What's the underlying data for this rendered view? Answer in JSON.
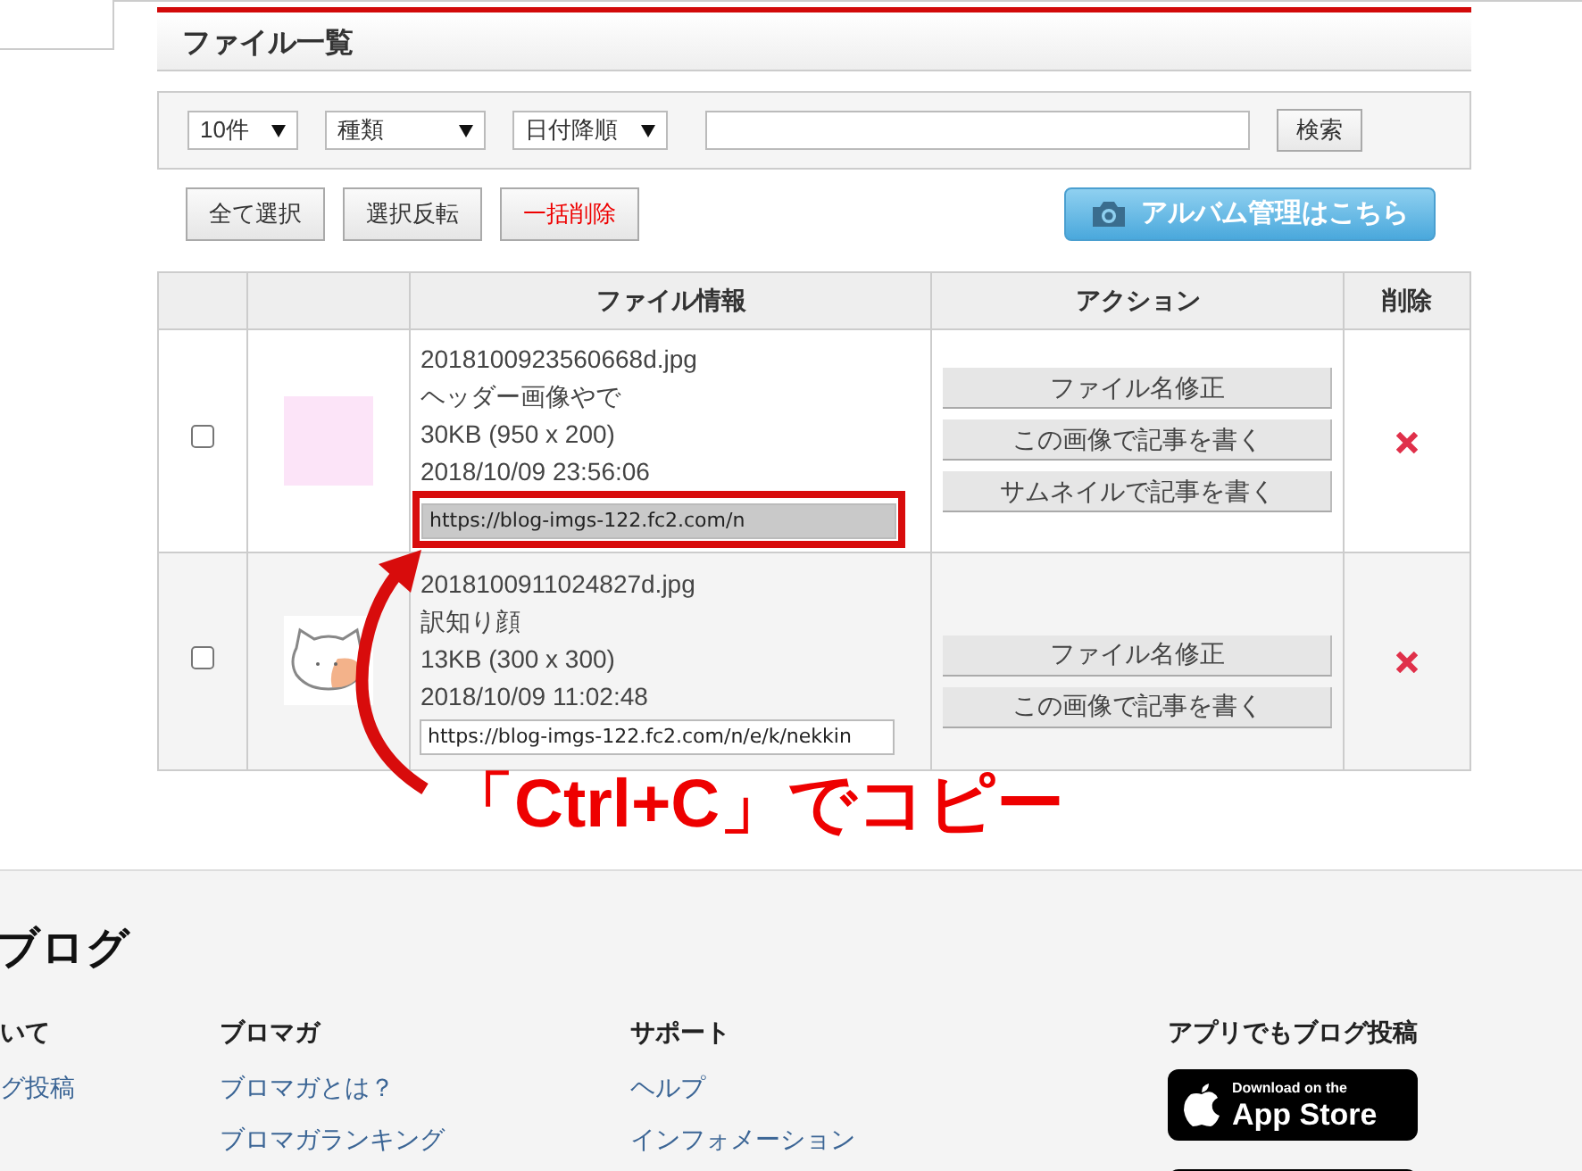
{
  "page_title": "ファイル一覧",
  "filters": {
    "count": "10件",
    "type": "種類",
    "sort": "日付降順",
    "search_button": "検索"
  },
  "actions": [
    {
      "label": "全て選択",
      "kind": "normal"
    },
    {
      "label": "選択反転",
      "kind": "normal"
    },
    {
      "label": "一括削除",
      "kind": "danger"
    }
  ],
  "album_button": "アルバム管理はこちら",
  "table": {
    "columns": [
      "ファイル情報",
      "アクション",
      "削除"
    ],
    "rows": [
      {
        "checked": false,
        "kind": "swatch",
        "filename": "2018100923560668d.jpg",
        "caption": "ヘッダー画像やで",
        "size": "30KB (950 x 200)",
        "date": "2018/10/09 23:56:06",
        "url": "https://blog-imgs-122.fc2.com/n",
        "highlighted": true,
        "buttons": [
          "ファイル名修正",
          "この画像で記事を書く",
          "サムネイルで記事を書く"
        ]
      },
      {
        "checked": false,
        "kind": "cat",
        "filename": "2018100911024827d.jpg",
        "caption": "訳知り顔",
        "size": "13KB (300 x 300)",
        "date": "2018/10/09 11:02:48",
        "url": "https://blog-imgs-122.fc2.com/n/e/k/nekkin",
        "highlighted": false,
        "buttons": [
          "ファイル名修正",
          "この画像で記事を書く"
        ]
      }
    ]
  },
  "annotation": {
    "text": "「Ctrl+C」でコピー"
  },
  "footer": {
    "heading": "ブログ",
    "columns": [
      {
        "title": "いて",
        "links": [
          "グ投稿"
        ]
      },
      {
        "title": "ブロマガ",
        "links": [
          "ブロマガとは？",
          "ブロマガランキング"
        ]
      },
      {
        "title": "サポート",
        "links": [
          "ヘルプ",
          "インフォメーション"
        ]
      },
      {
        "title": "アプリでもブログ投稿",
        "badges": [
          {
            "kind": "app_store",
            "small": "Download on the",
            "big": "App Store"
          },
          {
            "kind": "blank"
          }
        ]
      }
    ]
  }
}
